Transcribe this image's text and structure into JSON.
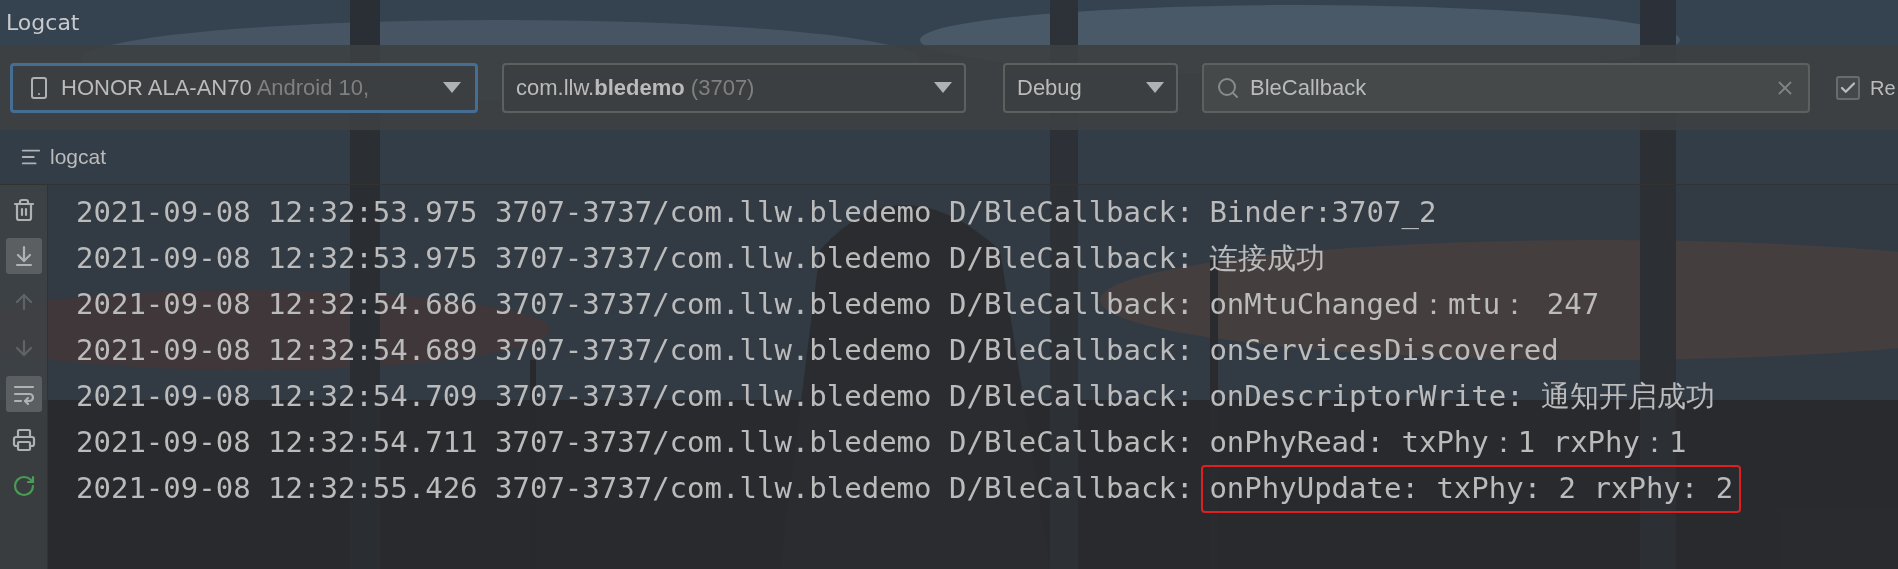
{
  "window": {
    "title": "Logcat"
  },
  "toolbar": {
    "device": {
      "name": "HONOR ALA-AN70",
      "detail": "Android 10,",
      "selected": true
    },
    "process": {
      "prefix": "com.llw.",
      "app": "bledemo",
      "pid": "(3707)"
    },
    "log_level": "Debug",
    "search": {
      "value": "BleCallback"
    },
    "regex": {
      "label": "Re",
      "checked": true
    }
  },
  "tab": {
    "label": "logcat"
  },
  "sidebar": {
    "tools": [
      {
        "kind": "delete",
        "on": false,
        "disabled": false
      },
      {
        "kind": "scroll_end",
        "on": true,
        "disabled": false
      },
      {
        "kind": "up",
        "on": false,
        "disabled": true
      },
      {
        "kind": "down",
        "on": false,
        "disabled": true
      },
      {
        "kind": "wrap",
        "on": true,
        "disabled": false
      },
      {
        "kind": "print",
        "on": false,
        "disabled": false
      },
      {
        "kind": "restart",
        "on": false,
        "disabled": false
      }
    ]
  },
  "log": {
    "lines": [
      {
        "header": "2021-09-08 12:32:53.975 3707-3737/com.llw.bledemo D/BleCallback:",
        "message": "Binder:3707_2",
        "highlighted": false
      },
      {
        "header": "2021-09-08 12:32:53.975 3707-3737/com.llw.bledemo D/BleCallback:",
        "message": "连接成功",
        "highlighted": false
      },
      {
        "header": "2021-09-08 12:32:54.686 3707-3737/com.llw.bledemo D/BleCallback:",
        "message": "onMtuChanged：mtu：  247",
        "highlighted": false
      },
      {
        "header": "2021-09-08 12:32:54.689 3707-3737/com.llw.bledemo D/BleCallback:",
        "message": "onServicesDiscovered",
        "highlighted": false
      },
      {
        "header": "2021-09-08 12:32:54.709 3707-3737/com.llw.bledemo D/BleCallback:",
        "message": "onDescriptorWrite: 通知开启成功",
        "highlighted": false
      },
      {
        "header": "2021-09-08 12:32:54.711 3707-3737/com.llw.bledemo D/BleCallback:",
        "message": "onPhyRead: txPhy：1 rxPhy：1",
        "highlighted": false
      },
      {
        "header": "2021-09-08 12:32:55.426 3707-3737/com.llw.bledemo D/BleCallback:",
        "message": "onPhyUpdate: txPhy: 2 rxPhy: 2",
        "highlighted": true
      }
    ]
  }
}
